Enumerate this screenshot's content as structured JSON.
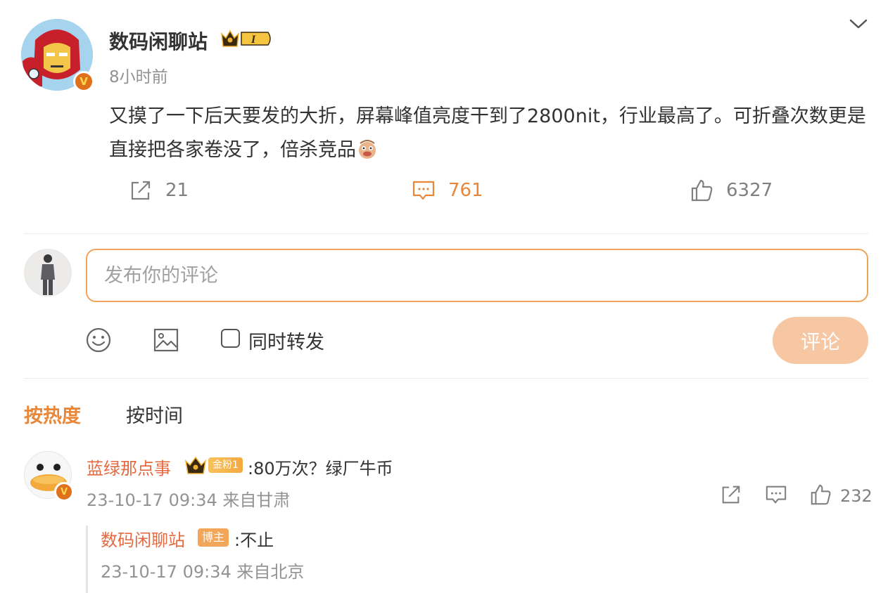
{
  "post": {
    "author": "数码闲聊站",
    "vip_level": "I",
    "time": "8小时前",
    "text": "又摸了一下后天要发的大折，屏幕峰值亮度干到了2800nit，行业最高了。可折叠次数更是直接把各家卷没了，倍杀竞品",
    "verified_mark": "V",
    "emoji": "doge-emoji"
  },
  "actions": {
    "repost_count": "21",
    "comment_count": "761",
    "like_count": "6327"
  },
  "composer": {
    "placeholder": "发布你的评论",
    "value": "",
    "also_repost_label": "同时转发",
    "submit_label": "评论"
  },
  "sort": {
    "hot_label": "按热度",
    "time_label": "按时间",
    "active": "hot"
  },
  "comments": [
    {
      "user": "蓝绿那点事",
      "fan_badge": "金粉1",
      "verified_mark": "V",
      "text": ":80万次？绿厂牛币",
      "meta": "23-10-17 09:34 来自甘肃",
      "like_count": "232",
      "replies": [
        {
          "user": "数码闲聊站",
          "tag": "博主",
          "text": ":不止",
          "meta": "23-10-17 09:34 来自北京"
        }
      ]
    }
  ],
  "colors": {
    "accent": "#e8873a",
    "username": "#e56a42",
    "input_border": "#f0a35c",
    "submit_bg": "#f6c7a2",
    "meta_text": "#939393"
  },
  "icons": {
    "repost": "repost-icon",
    "comment": "comment-icon",
    "like": "thumbs-up-icon",
    "emoji": "smiley-icon",
    "image": "image-icon",
    "chevron": "chevron-down-icon"
  }
}
